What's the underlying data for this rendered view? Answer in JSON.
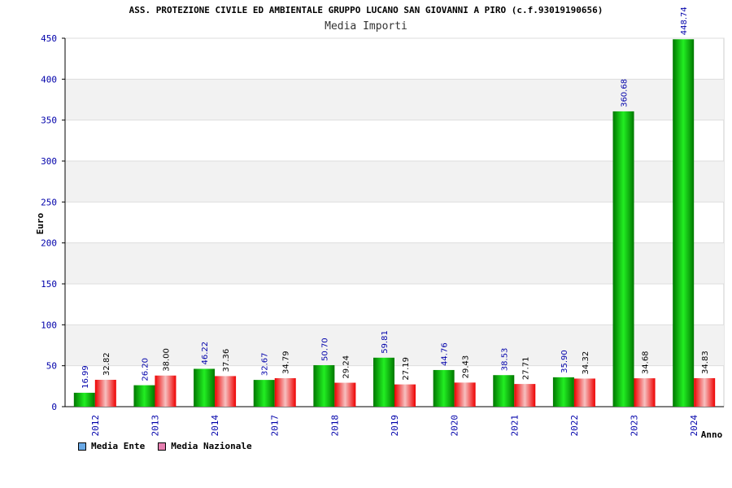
{
  "header": {
    "title": "ASS. PROTEZIONE CIVILE ED AMBIENTALE GRUPPO LUCANO SAN GIOVANNI A PIRO (c.f.93019190656)",
    "subtitle": "Media Importi"
  },
  "legend": {
    "items": [
      {
        "label": "Media Ente",
        "color": "#6aa9e6"
      },
      {
        "label": "Media Nazionale",
        "color": "#e67fb0"
      }
    ]
  },
  "colors": {
    "ente_dark": "#007700",
    "ente_light": "#22ee22",
    "naz_dark": "#ee0000",
    "naz_light": "#f6c0c0",
    "axis_labels": "#0000aa",
    "grid": "#dddddd",
    "band": "#f2f2f2"
  },
  "chart_data": {
    "type": "bar",
    "title": "ASS. PROTEZIONE CIVILE ED AMBIENTALE GRUPPO LUCANO SAN GIOVANNI A PIRO (c.f.93019190656)",
    "subtitle": "Media Importi",
    "xlabel": "Anno",
    "ylabel": "Euro",
    "ylim": [
      0,
      450
    ],
    "yticks": [
      0,
      50,
      100,
      150,
      200,
      250,
      300,
      350,
      400,
      450
    ],
    "categories": [
      "2012",
      "2013",
      "2014",
      "2017",
      "2018",
      "2019",
      "2020",
      "2021",
      "2022",
      "2023",
      "2024"
    ],
    "series": [
      {
        "name": "Media Ente",
        "values": [
          16.99,
          26.2,
          46.22,
          32.67,
          50.7,
          59.81,
          44.76,
          38.53,
          35.9,
          360.68,
          448.74
        ],
        "labels": [
          "16.99",
          "26.20",
          "46.22",
          "32.67",
          "50.70",
          "59.81",
          "44.76",
          "38.53",
          "35.90",
          "360.68",
          "448.74"
        ]
      },
      {
        "name": "Media Nazionale",
        "values": [
          32.82,
          38.0,
          37.36,
          34.79,
          29.24,
          27.19,
          29.43,
          27.71,
          34.32,
          34.68,
          34.83
        ],
        "labels": [
          "32.82",
          "38.00",
          "37.36",
          "34.79",
          "29.24",
          "27.19",
          "29.43",
          "27.71",
          "34.32",
          "34.68",
          "34.83"
        ]
      }
    ],
    "grid": true,
    "legend_position": "bottom-left"
  }
}
